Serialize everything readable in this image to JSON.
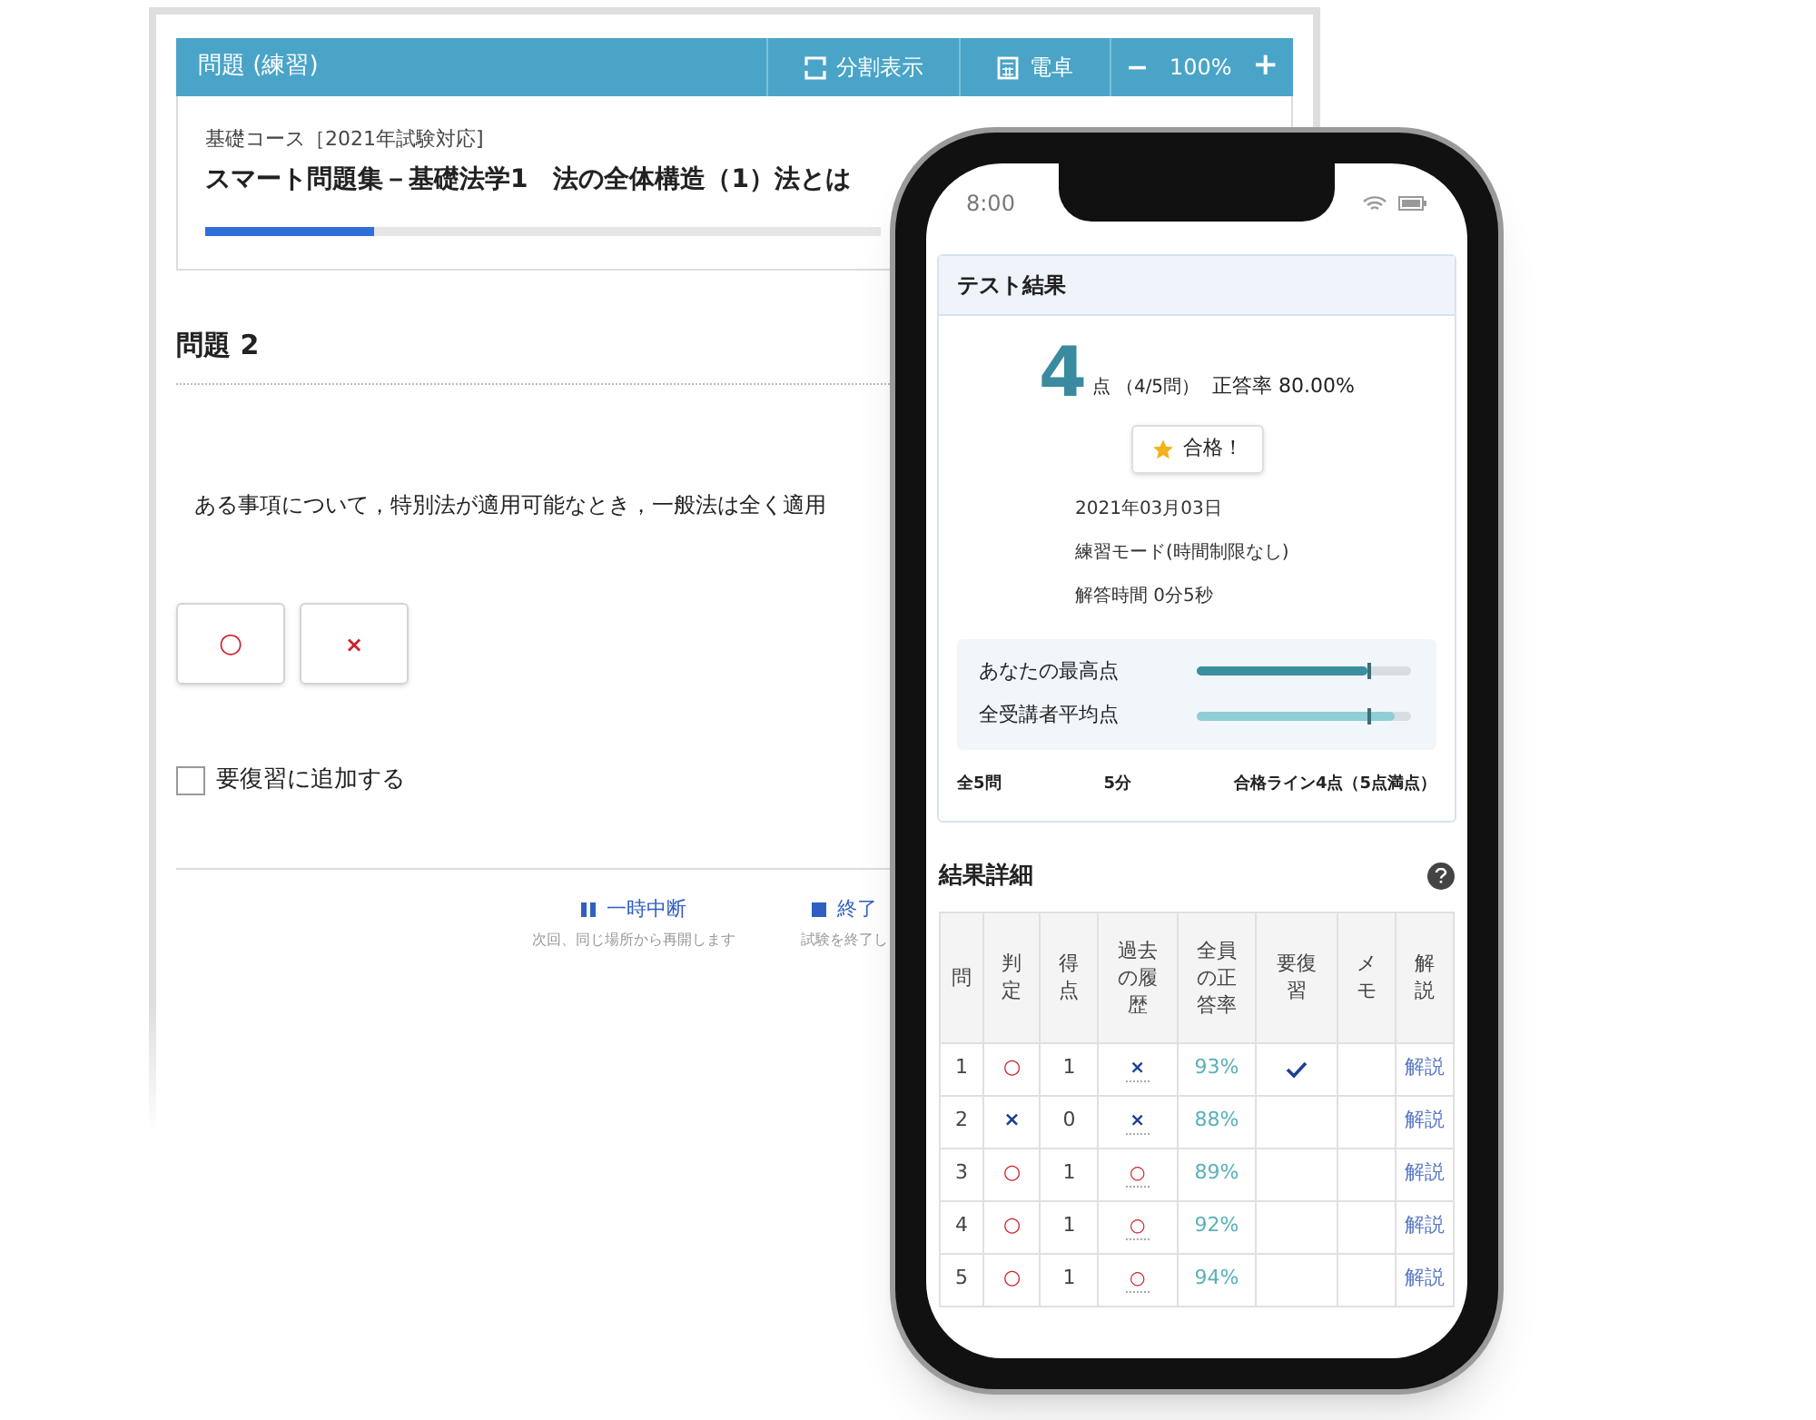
{
  "exam_window": {
    "header": {
      "title": "問題 (練習)",
      "split_view": "分割表示",
      "calculator": "電卓",
      "zoom_out": "−",
      "zoom_level": "100%",
      "zoom_in": "+"
    },
    "course": "基礎コース［2021年試験対応]",
    "title": "スマート問題集－基礎法学1　法の全体構造（1）法とは",
    "progress": {
      "level": 0.25
    },
    "question_heading": "問題 2",
    "question_text": "ある事項について，特別法が適用可能なとき，一般法は全く適用",
    "answers": [
      {
        "kind": "circle",
        "label": "○"
      },
      {
        "kind": "cross",
        "label": "×"
      }
    ],
    "review_checkbox": {
      "label": "要復習に追加する",
      "checked": false
    },
    "footer_actions": [
      {
        "kind": "pause",
        "label": "一時中断",
        "note": "次回、同じ場所から再開します"
      },
      {
        "kind": "stop",
        "label": "終了",
        "note": "試験を終了し"
      }
    ]
  },
  "phone": {
    "status_time": "8:00",
    "result_card": {
      "title": "テスト結果",
      "score": "4",
      "score_unit": "点",
      "question_count": "（4/5問）",
      "accuracy": "正答率 80.00%",
      "badge": "合格！",
      "info": [
        "2021年03月03日",
        "練習モード(時間制限なし)",
        "解答時間 0分5秒"
      ],
      "comparisons": [
        {
          "label": "あなたの最高点",
          "level": 0.8,
          "kind": "own"
        },
        {
          "label": "全受講者平均点",
          "level": 0.92,
          "kind": "average"
        }
      ],
      "summary": [
        "全5問",
        "5分",
        "合格ライン4点（5点満点）"
      ]
    },
    "details": {
      "title": "結果詳細",
      "columns": [
        "問",
        "判定",
        "得点",
        "過去の履歴",
        "全員の正答率",
        "要復習",
        "メモ",
        "解説"
      ],
      "rows": [
        {
          "number": "1",
          "result": "○",
          "result_correct": true,
          "score": "1",
          "history": "×",
          "history_correct": false,
          "rate": "93%",
          "review": true,
          "link": "解説"
        },
        {
          "number": "2",
          "result": "×",
          "result_correct": false,
          "score": "0",
          "history": "×",
          "history_correct": false,
          "rate": "88%",
          "review": false,
          "link": "解説"
        },
        {
          "number": "3",
          "result": "○",
          "result_correct": true,
          "score": "1",
          "history": "○",
          "history_correct": true,
          "rate": "89%",
          "review": false,
          "link": "解説"
        },
        {
          "number": "4",
          "result": "○",
          "result_correct": true,
          "score": "1",
          "history": "○",
          "history_correct": true,
          "rate": "92%",
          "review": false,
          "link": "解説"
        },
        {
          "number": "5",
          "result": "○",
          "result_correct": true,
          "score": "1",
          "history": "○",
          "history_correct": true,
          "rate": "94%",
          "review": false,
          "link": "解説"
        }
      ]
    }
  }
}
